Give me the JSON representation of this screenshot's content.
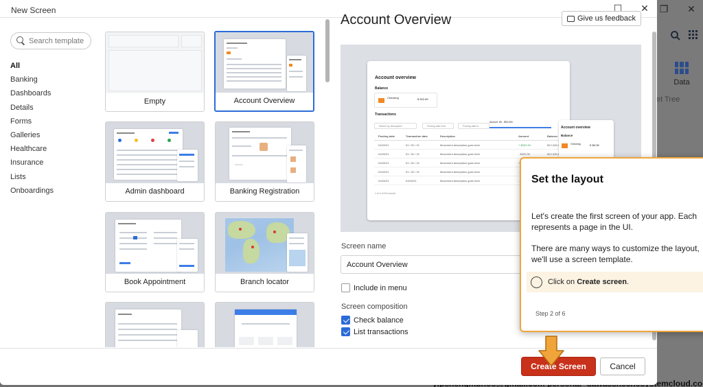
{
  "dialog": {
    "title": "New Screen",
    "maximize_glyph": "☐",
    "close_glyph": "✕"
  },
  "background_app": {
    "restore_glyph": "❐",
    "close_glyph": "✕",
    "data_label": "Data",
    "tree_label": "et Tree",
    "email_text": "yipshengmbnoo@gmail.com   personal- dawassnechesystemcloud.com"
  },
  "search": {
    "placeholder": "Search template"
  },
  "categories": [
    {
      "label": "All",
      "active": true
    },
    {
      "label": "Banking"
    },
    {
      "label": "Dashboards"
    },
    {
      "label": "Details"
    },
    {
      "label": "Forms"
    },
    {
      "label": "Galleries"
    },
    {
      "label": "Healthcare"
    },
    {
      "label": "Insurance"
    },
    {
      "label": "Lists"
    },
    {
      "label": "Onboardings"
    }
  ],
  "templates": [
    {
      "label": "Empty"
    },
    {
      "label": "Account Overview",
      "selected": true
    },
    {
      "label": "Admin dashboard"
    },
    {
      "label": "Banking Registration"
    },
    {
      "label": "Book Appointment"
    },
    {
      "label": "Branch locator"
    }
  ],
  "preview": {
    "title": "Account Overview",
    "feedback_label": "Give us feedback",
    "mock": {
      "heading": "Account overview",
      "balance_label": "Balance",
      "checking_label": "Checking",
      "checking_amount": "$ 902.89",
      "transactions_label": "Transactions",
      "search_placeholder": "Search by description",
      "from_placeholder": "Posting date from",
      "to_placeholder": "Posting date to",
      "amount_label": "Amount",
      "amount_range": "$0 - $50,000",
      "columns": [
        "Posting date",
        "Transaction date",
        "Description",
        "Amount",
        "Balance"
      ],
      "rows": [
        [
          "01/02/21",
          "01 / 02 / 21",
          "Movement description goes here",
          "+ $322.00",
          "$12,345.67"
        ],
        [
          "01/02/21",
          "01 / 02 / 21",
          "Movement description goes here",
          "- $322.00",
          "$12,345.67"
        ],
        [
          "01/02/21",
          "01 / 02 / 21",
          "Movement description goes here",
          "+ $322.00",
          "$12,345.67"
        ],
        [
          "01/02/21",
          "01 / 02 / 21",
          "Movement description goes here",
          "- $322.00",
          "$12,345.67"
        ],
        [
          "01/02/21",
          "01/02/21",
          "Movement description goes here",
          "- $322.00",
          "$12,345.67"
        ]
      ],
      "pagination": "1 to 5 of 50 records",
      "side_heading": "Account overview",
      "side_balance": "Balance",
      "side_checking": "Checking",
      "side_amount": "$ 382.89"
    }
  },
  "form": {
    "screen_name_label": "Screen name",
    "screen_name_value": "Account Overview",
    "include_menu_label": "Include in menu",
    "include_menu_checked": false,
    "composition_label": "Screen composition",
    "composition": [
      {
        "label": "Check balance",
        "checked": true
      },
      {
        "label": "List transactions",
        "checked": true
      }
    ]
  },
  "footer": {
    "create_label": "Create Screen",
    "cancel_label": "Cancel"
  },
  "popover": {
    "title": "Set the layout",
    "paragraph1_line1": "Let's create the first screen of your app. Each",
    "paragraph1_line2": "represents a page in the UI.",
    "paragraph2_line1": "There are many ways to customize the layout,",
    "paragraph2_line2": "we'll use a screen template.",
    "task_prefix": "Click on ",
    "task_bold": "Create screen",
    "task_suffix": ".",
    "step": "Step 2 of 6"
  },
  "colors": {
    "accent_blue": "#2b6bd8",
    "create_red": "#c8311a",
    "popover_orange": "#f0a43a"
  }
}
